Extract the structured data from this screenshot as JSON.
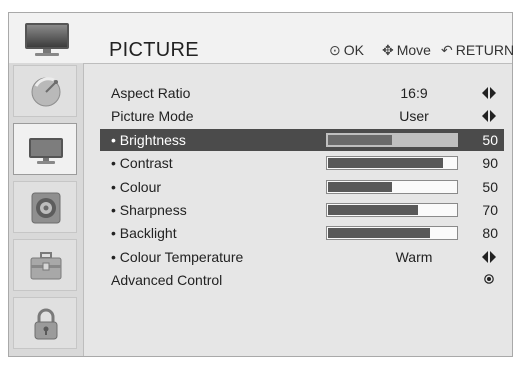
{
  "header": {
    "title": "PICTURE",
    "hints": {
      "ok_glyph": "⊙",
      "ok_label": "OK",
      "move_glyph": "✥",
      "move_label": "Move",
      "return_glyph": "↶",
      "return_label": "RETURN"
    }
  },
  "sidebar": {
    "items": [
      {
        "name": "satellite-dish-icon",
        "label": ""
      },
      {
        "name": "tv-monitor-icon",
        "label": "",
        "active": true
      },
      {
        "name": "speaker-icon",
        "label": ""
      },
      {
        "name": "toolbox-icon",
        "label": ""
      },
      {
        "name": "lock-icon",
        "label": ""
      }
    ]
  },
  "menu": {
    "rows": [
      {
        "label": "Aspect Ratio",
        "kind": "option",
        "value": "16:9"
      },
      {
        "label": "Picture Mode",
        "kind": "option",
        "value": "User"
      },
      {
        "label": "• Brightness",
        "kind": "slider",
        "value": 50,
        "selected": true
      },
      {
        "label": "• Contrast",
        "kind": "slider",
        "value": 90
      },
      {
        "label": "• Colour",
        "kind": "slider",
        "value": 50
      },
      {
        "label": "• Sharpness",
        "kind": "slider",
        "value": 70
      },
      {
        "label": "• Backlight",
        "kind": "slider",
        "value": 80
      },
      {
        "label": "• Colour Temperature",
        "kind": "option",
        "value": "Warm"
      },
      {
        "label": "Advanced Control",
        "kind": "enter",
        "value": ""
      }
    ],
    "slider_max": 100
  },
  "colors": {
    "selected_row": "#4b4b4b",
    "bar_fill": "#595959",
    "panel_bg": "#e6e6e6"
  }
}
